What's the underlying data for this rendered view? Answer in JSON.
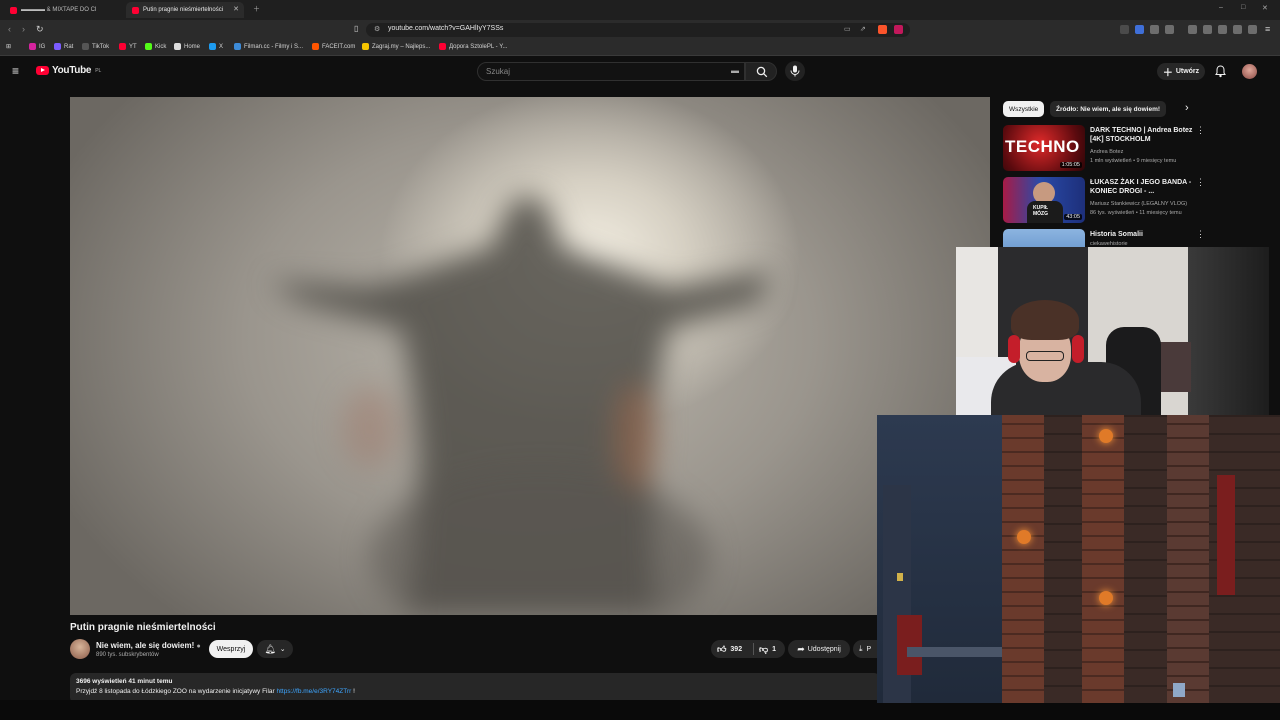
{
  "browser": {
    "tabs": [
      {
        "label": "▬▬▬▬ & MIXTAPE DO CI"
      },
      {
        "label": "Putin pragnie nieśmiertelności",
        "active": true
      }
    ],
    "url": "youtube.com/watch?v=GAHlIyY7SSs",
    "bookmarks": [
      {
        "label": "IG",
        "color": "#d6249f"
      },
      {
        "label": "Rat",
        "color": "#7b5cff"
      },
      {
        "label": "TikTok",
        "color": "#222222"
      },
      {
        "label": "YT",
        "color": "#ff0033"
      },
      {
        "label": "Kick",
        "color": "#53fc18"
      },
      {
        "label": "Home",
        "color": "#ffffff"
      },
      {
        "label": "X",
        "color": "#1d9bf0"
      },
      {
        "label": "Filman.cc - Filmy i S...",
        "color": "#3d8bd8"
      },
      {
        "label": "FACEIT.com",
        "color": "#ff5500"
      },
      {
        "label": "Zagraj.my – Najleps...",
        "color": "#f5c400"
      },
      {
        "label": "Дорога SztolePL - Y...",
        "color": "#ff0033"
      }
    ]
  },
  "youtube": {
    "logo_text": "YouTube",
    "logo_region": "PL",
    "search_placeholder": "Szukaj",
    "create_label": "Utwórz"
  },
  "video": {
    "title": "Putin pragnie nieśmiertelności",
    "channel": "Nie wiem, ale się dowiem!",
    "subscribers": "890 tys. subskrybentów",
    "support_label": "Wesprzyj",
    "likes": "392",
    "dislikes": "1",
    "share_label": "Udostępnij",
    "download_label": "P",
    "views_line": "3696 wyświetleń  41 minut temu",
    "desc_line": "Przyjdź 8 listopada do Łódzkiego ZOO na wydarzenie inicjatywy Filar ",
    "desc_link": "https://fb.me/e/3RY74ZTrr",
    "desc_tail": " !"
  },
  "sidebar": {
    "chips": [
      "Wszystkie",
      "Źródło: Nie wiem, ale się dowiem!"
    ],
    "recommendations": [
      {
        "title": "DARK TECHNO | Andrea Botez [4K] STOCKHOLM",
        "channel": "Andrea Botez",
        "meta": "1 mln wyświetleń • 9 miesięcy temu",
        "duration": "1:05:05",
        "thumb_text": "TECHNO",
        "thumb_color": "#b3121c"
      },
      {
        "title": "ŁUKASZ ŻAK I JEGO BANDA - KONIEC DROGI - ...",
        "channel": "Mariusz Stankiewicz (LEGALNY VLOG)",
        "meta": "86 tys. wyświetleń • 11 miesięcy temu",
        "duration": "43:05",
        "thumb_text": "KUPIŁ MÓZG",
        "thumb_color": "#2a4aa8"
      },
      {
        "title": "Historia Somalii",
        "channel": "ciekawehistorie",
        "meta": "",
        "duration": "",
        "thumb_text": "",
        "thumb_color": "#5a8cc8"
      }
    ]
  }
}
